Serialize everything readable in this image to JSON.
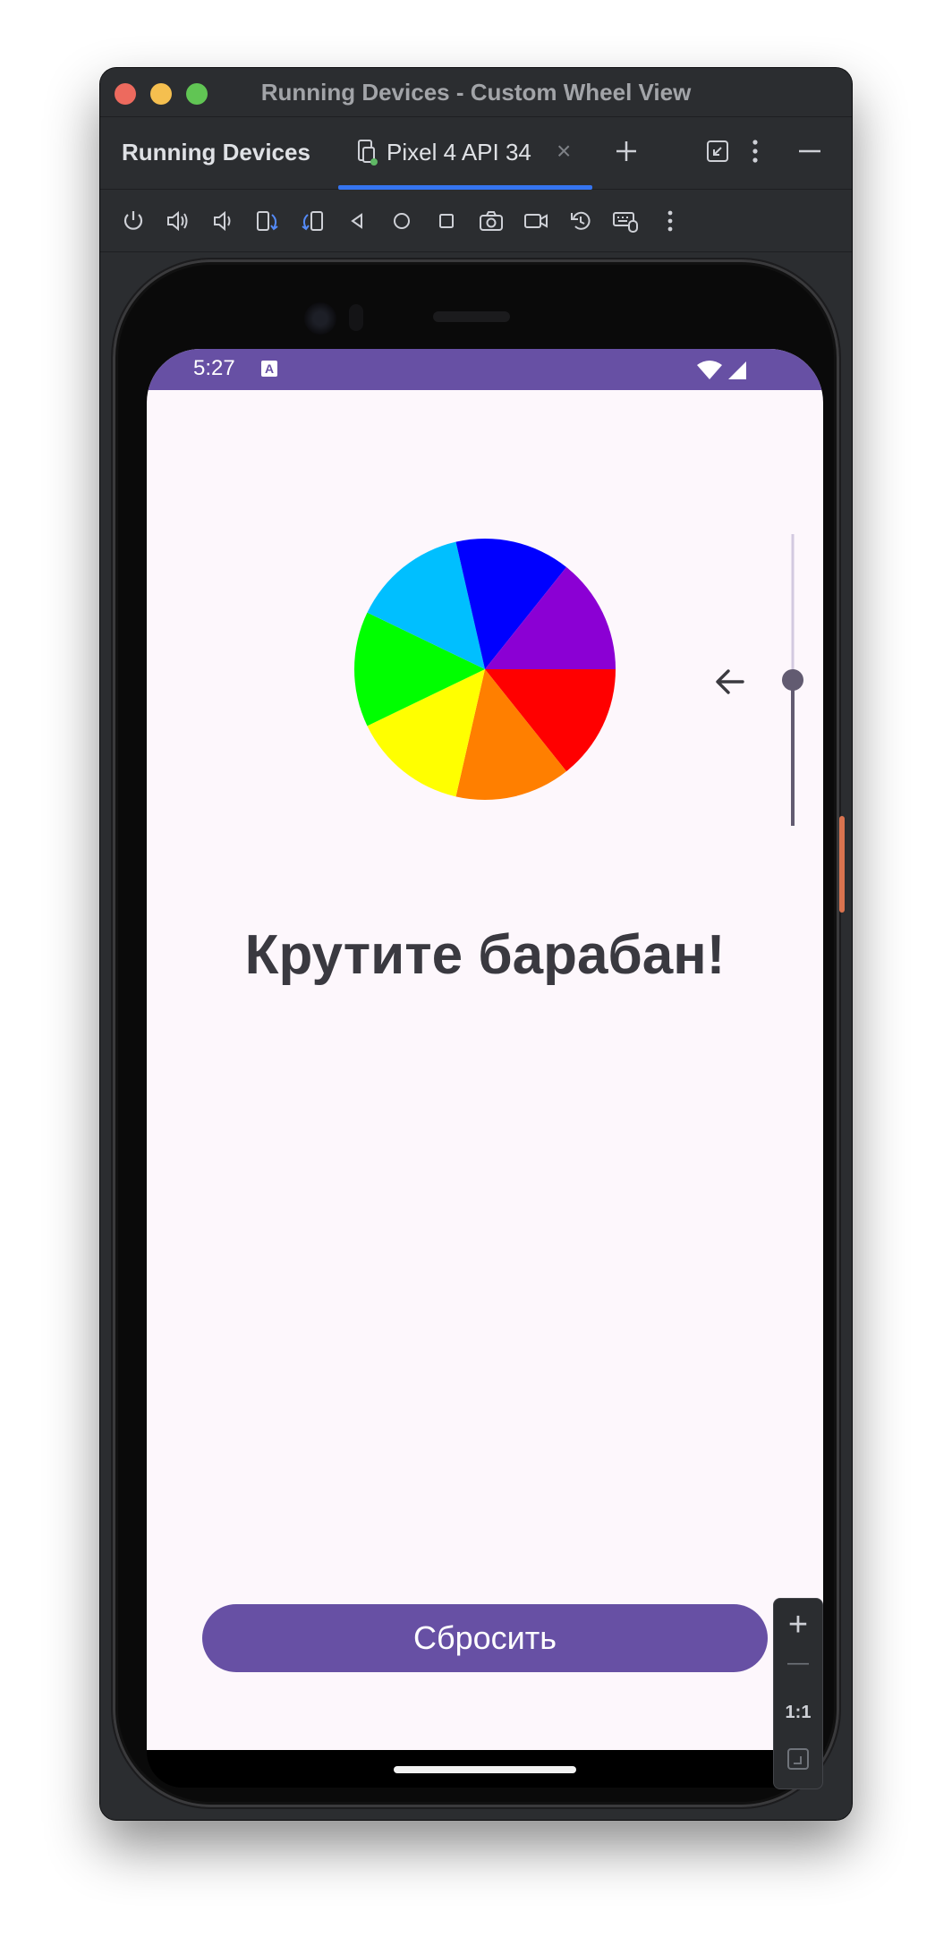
{
  "window": {
    "title": "Running Devices - Custom Wheel View",
    "panel_title": "Running Devices",
    "tab_label": "Pixel 4 API 34",
    "tab_close": "×"
  },
  "toolbar": {
    "icons": [
      "power-icon",
      "volume-up-icon",
      "volume-down-icon",
      "rotate-left-icon",
      "rotate-right-icon",
      "back-icon",
      "home-icon",
      "overview-icon",
      "screenshot-icon",
      "screen-record-icon",
      "reset-icon",
      "keyboard-mouse-icon",
      "more-icon"
    ]
  },
  "status_bar": {
    "time": "5:27",
    "color": "#6750a4"
  },
  "wheel": {
    "colors": [
      "#ff0000",
      "#ff7f00",
      "#ffff00",
      "#00ff00",
      "#00bfff",
      "#0000ff",
      "#8b00d4"
    ]
  },
  "app": {
    "headline": "Крутите барабан!",
    "reset_label": "Сбросить",
    "slider_level": 0.5,
    "accent": "#6750a4"
  },
  "zoom": {
    "plus": "+",
    "minus": "—",
    "one_to_one": "1:1"
  }
}
